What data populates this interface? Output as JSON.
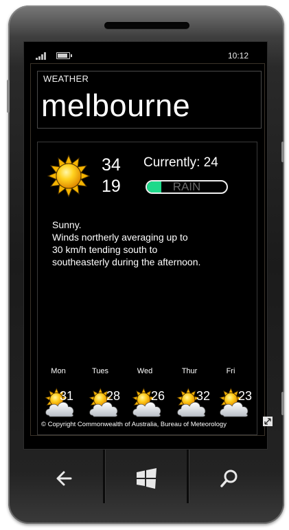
{
  "status_bar": {
    "time": "10:12",
    "signal_icon": "signal-icon",
    "battery_icon": "battery-icon"
  },
  "app": {
    "title": "WEATHER",
    "city": "melbourne"
  },
  "today": {
    "icon": "sunny-icon",
    "high": "34",
    "low": "19",
    "currently": "Currently: 24",
    "rain_label": "RAIN",
    "rain_fraction": 0.18,
    "forecast_lines": [
      "Sunny.",
      "Winds northerly averaging up to",
      "30 km/h tending south to",
      "southeasterly during the afternoon."
    ]
  },
  "days": [
    {
      "label": "Mon",
      "temp": "31",
      "icon": "partly-cloudy-icon"
    },
    {
      "label": "Tues",
      "temp": "28",
      "icon": "partly-cloudy-icon"
    },
    {
      "label": "Wed",
      "temp": "26",
      "icon": "partly-cloudy-icon"
    },
    {
      "label": "Thur",
      "temp": "32",
      "icon": "partly-cloudy-icon"
    },
    {
      "label": "Fri",
      "temp": "23",
      "icon": "partly-cloudy-icon"
    }
  ],
  "copyright": "© Copyright Commonwealth of Australia, Bureau of Meteorology",
  "hardware_buttons": {
    "back": "back-arrow-icon",
    "start": "windows-logo-icon",
    "search": "search-icon"
  },
  "colors": {
    "rain_fill": "#1ed98a",
    "background": "#000000",
    "text": "#ffffff"
  }
}
